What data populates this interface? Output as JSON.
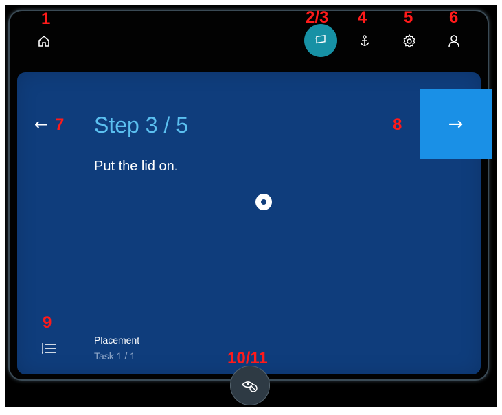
{
  "callouts": {
    "n1": "1",
    "n23": "2/3",
    "n4": "4",
    "n5": "5",
    "n6": "6",
    "n7": "7",
    "n8": "8",
    "n9": "9",
    "n1011": "10/11"
  },
  "step": {
    "title": "Step 3 / 5",
    "instruction": "Put the lid on."
  },
  "task": {
    "name": "Placement",
    "progress": "Task 1 / 1"
  },
  "nav": {
    "back_arrow": "←",
    "next_arrow": "→"
  },
  "icons": {
    "home": "home-icon",
    "content": "holograms-icon",
    "anchor": "anchor-icon",
    "settings": "gear-icon",
    "profile": "person-icon",
    "task_list": "list-icon",
    "visibility": "hide-eye-icon"
  },
  "colors": {
    "card_bg": "#0f3d7c",
    "title": "#5bc0f0",
    "next_button": "#1a90e6",
    "active_toggle": "#1791a5",
    "callout": "#ff1a1a"
  }
}
